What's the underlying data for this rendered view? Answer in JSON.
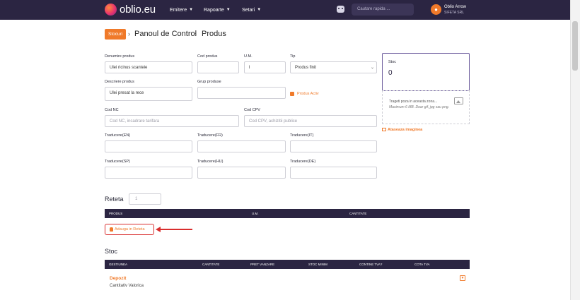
{
  "header": {
    "logo_text": "oblio.eu",
    "nav": [
      {
        "label": "Emitere"
      },
      {
        "label": "Rapoarte"
      },
      {
        "label": "Setari"
      }
    ],
    "search_placeholder": "Cautare rapida ...",
    "user": {
      "name": "Oblio Arrow",
      "company": "SIFETA SRL",
      "avatar_icon": "user-icon"
    }
  },
  "breadcrumb": {
    "badge": "Stocuri",
    "level1": "Panoul de Control",
    "level2": "Produs"
  },
  "form": {
    "denumire": {
      "label": "Denumire produs",
      "value": "Ulei ricinus scanteie"
    },
    "cod_produs": {
      "label": "Cod produs",
      "value": ""
    },
    "um": {
      "label": "U.M.",
      "value": "l"
    },
    "tip": {
      "label": "Tip",
      "value": "Produs finit"
    },
    "descriere": {
      "label": "Descriere produs",
      "value": "Ulei presat la rece"
    },
    "grup": {
      "label": "Grup produse",
      "value": ""
    },
    "produs_activ": {
      "label": "Produs Activ",
      "checked": true
    },
    "cod_nc": {
      "label": "Cod NC",
      "placeholder": "Cod NC, incadrare tarifara"
    },
    "cod_cpv": {
      "label": "Cod CPV",
      "placeholder": "Cod CPV, achizitii publice"
    },
    "traduceri": [
      {
        "label": "Traducere(EN)"
      },
      {
        "label": "Traducere(FR)"
      },
      {
        "label": "Traducere(IT)"
      },
      {
        "label": "Traducere(SP)"
      },
      {
        "label": "Traducere(HU)"
      },
      {
        "label": "Traducere(DE)"
      }
    ]
  },
  "stoc_card": {
    "title": "Stoc",
    "value": "0"
  },
  "image_upload": {
    "line1": "Trageti poza in aceasta zona...",
    "line2": "Maximum 6 MB. Doar gif, jpg sau png.",
    "attach_label": "Ataseaza imaginea"
  },
  "reteta": {
    "title": "Reteta",
    "qty": "1",
    "columns": [
      "PRODUS",
      "U.M.",
      "CANTITATE"
    ],
    "add_label": "Adauga in Reteta"
  },
  "stoc_section": {
    "title": "Stoc",
    "columns": [
      "GESTIUNEA",
      "CANTITATE",
      "PRET VANZARE",
      "STOC MINIM",
      "CONTINE TVA?",
      "COTA TVA"
    ],
    "rows": [
      {
        "name": "Depozit",
        "sub": "Cantitativ Valorica"
      }
    ]
  },
  "colors": {
    "brand_dark": "#2b2542",
    "accent": "#f07a2a",
    "highlight": "#d92d2d"
  }
}
